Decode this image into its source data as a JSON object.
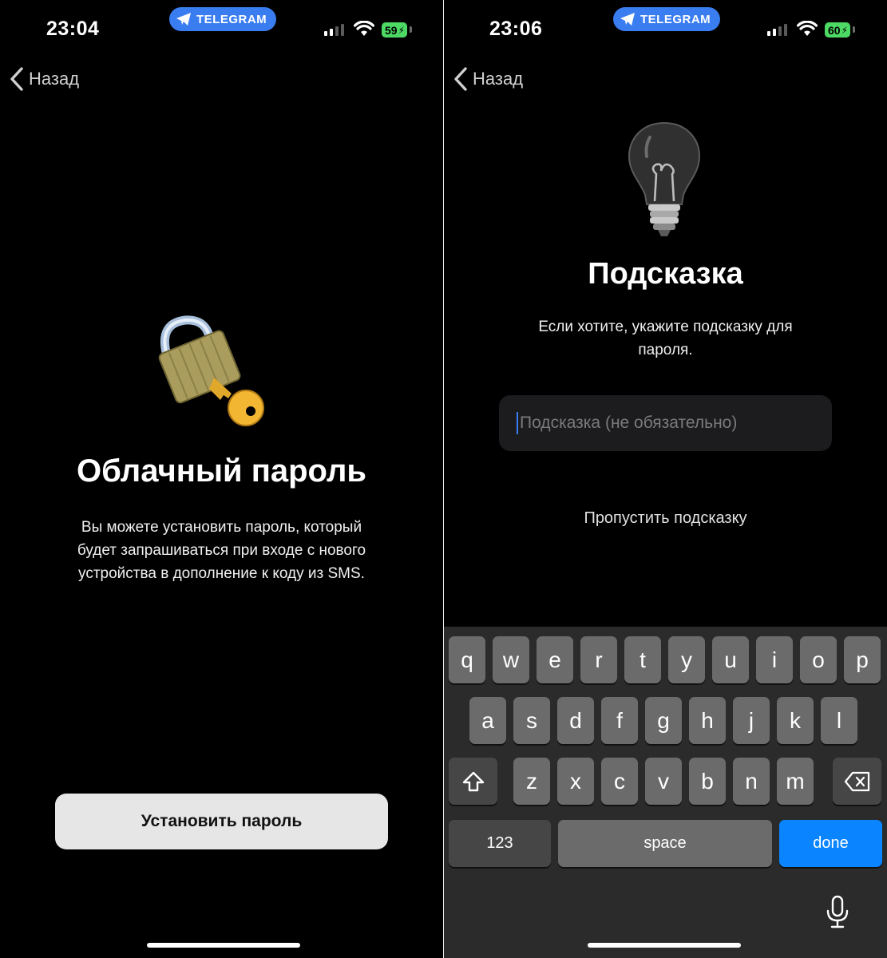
{
  "colors": {
    "background": "#000000",
    "accent": "#0a84ff",
    "pill": "#3a7df0",
    "battery": "#4cd964"
  },
  "screen1": {
    "status": {
      "time": "23:04",
      "pill_label": "TELEGRAM",
      "battery": "59"
    },
    "back_label": "Назад",
    "icon": "lock-with-key-emoji",
    "title": "Облачный пароль",
    "description_lines": [
      "Вы можете установить пароль, который",
      "будет запрашиваться при входе с нового",
      "устройства в дополнение к коду из SMS."
    ],
    "button_label": "Установить пароль"
  },
  "screen2": {
    "status": {
      "time": "23:06",
      "pill_label": "TELEGRAM",
      "battery": "60"
    },
    "back_label": "Назад",
    "icon": "light-bulb-emoji",
    "title": "Подсказка",
    "description_lines": [
      "Если хотите, укажите подсказку для",
      "пароля."
    ],
    "input": {
      "placeholder": "Подсказка (не обязательно)",
      "value": ""
    },
    "skip_label": "Пропустить подсказку",
    "keyboard": {
      "row1": [
        "q",
        "w",
        "e",
        "r",
        "t",
        "y",
        "u",
        "i",
        "o",
        "p"
      ],
      "row2": [
        "a",
        "s",
        "d",
        "f",
        "g",
        "h",
        "j",
        "k",
        "l"
      ],
      "row3": [
        "z",
        "x",
        "c",
        "v",
        "b",
        "n",
        "m"
      ],
      "shift_icon": "shift-arrow-icon",
      "delete_icon": "backspace-icon",
      "numbers_label": "123",
      "space_label": "space",
      "done_label": "done",
      "mic_icon": "microphone-icon"
    }
  }
}
